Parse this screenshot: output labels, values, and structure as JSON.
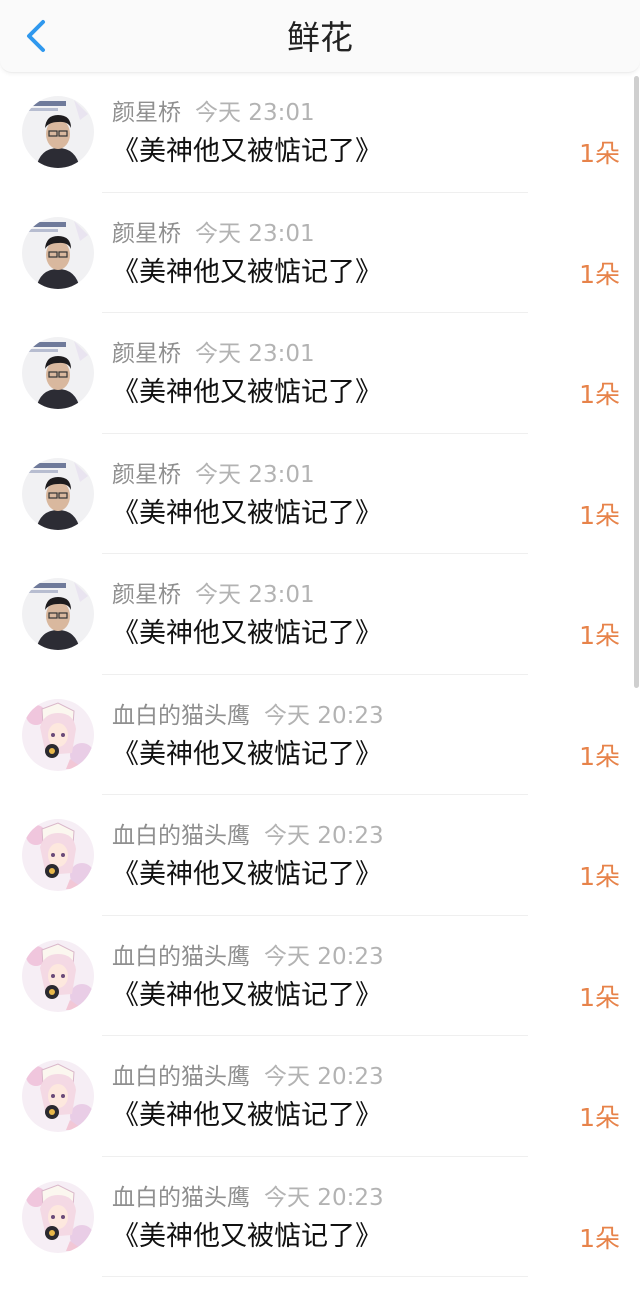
{
  "header": {
    "title": "鲜花",
    "back_icon": "chevron-left-icon",
    "accent_color": "#2f98ee"
  },
  "items": [
    {
      "user": "颜星桥",
      "time": "今天 23:01",
      "book": "《美神他又被惦记了》",
      "count": "1朵",
      "avatar": "photo-boy"
    },
    {
      "user": "颜星桥",
      "time": "今天 23:01",
      "book": "《美神他又被惦记了》",
      "count": "1朵",
      "avatar": "photo-boy"
    },
    {
      "user": "颜星桥",
      "time": "今天 23:01",
      "book": "《美神他又被惦记了》",
      "count": "1朵",
      "avatar": "photo-boy"
    },
    {
      "user": "颜星桥",
      "time": "今天 23:01",
      "book": "《美神他又被惦记了》",
      "count": "1朵",
      "avatar": "photo-boy"
    },
    {
      "user": "颜星桥",
      "time": "今天 23:01",
      "book": "《美神他又被惦记了》",
      "count": "1朵",
      "avatar": "photo-boy"
    },
    {
      "user": "血白的猫头鹰",
      "time": "今天 20:23",
      "book": "《美神他又被惦记了》",
      "count": "1朵",
      "avatar": "anime-girl"
    },
    {
      "user": "血白的猫头鹰",
      "time": "今天 20:23",
      "book": "《美神他又被惦记了》",
      "count": "1朵",
      "avatar": "anime-girl"
    },
    {
      "user": "血白的猫头鹰",
      "time": "今天 20:23",
      "book": "《美神他又被惦记了》",
      "count": "1朵",
      "avatar": "anime-girl"
    },
    {
      "user": "血白的猫头鹰",
      "time": "今天 20:23",
      "book": "《美神他又被惦记了》",
      "count": "1朵",
      "avatar": "anime-girl"
    },
    {
      "user": "血白的猫头鹰",
      "time": "今天 20:23",
      "book": "《美神他又被惦记了》",
      "count": "1朵",
      "avatar": "anime-girl"
    }
  ],
  "colors": {
    "count": "#e7834a",
    "username": "#8f8f8f",
    "time": "#b3b3b3",
    "book": "#111111"
  }
}
